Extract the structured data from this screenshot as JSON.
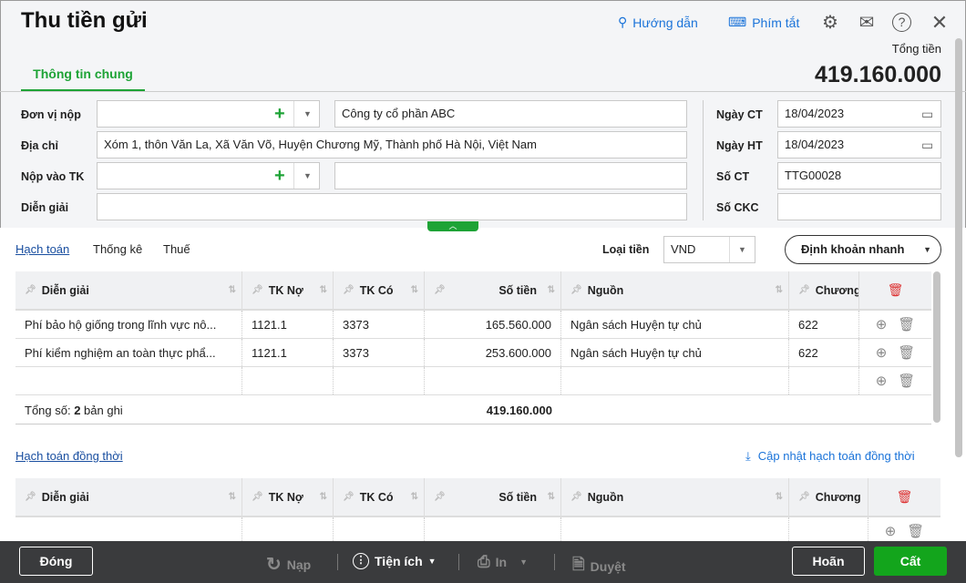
{
  "header": {
    "title": "Thu tiền gửi",
    "guide": "Hướng dẫn",
    "shortcuts": "Phím tắt",
    "total_label": "Tổng tiền",
    "total_value": "419.160.000"
  },
  "tabs": [
    {
      "label": "Thông tin chung",
      "active": true
    }
  ],
  "form": {
    "don_vi_nop": {
      "label": "Đơn vị nộp",
      "value": "",
      "name": "Công ty cổ phần ABC"
    },
    "dia_chi": {
      "label": "Địa chỉ",
      "value": "Xóm 1, thôn Văn La, Xã Văn Võ, Huyện Chương Mỹ, Thành phố Hà Nội, Việt Nam"
    },
    "nop_vao_tk": {
      "label": "Nộp vào TK",
      "value": "",
      "name": ""
    },
    "dien_giai": {
      "label": "Diễn giải",
      "value": ""
    },
    "ngay_ct": {
      "label": "Ngày CT",
      "value": "18/04/2023"
    },
    "ngay_ht": {
      "label": "Ngày HT",
      "value": "18/04/2023"
    },
    "so_ct": {
      "label": "Số CT",
      "value": "TTG00028"
    },
    "so_ckc": {
      "label": "Số CKC",
      "value": ""
    }
  },
  "detail_tabs": [
    "Hạch toán",
    "Thống kê",
    "Thuế"
  ],
  "currency": {
    "label": "Loại tiền",
    "value": "VND"
  },
  "quick_entry": "Định khoản nhanh",
  "columns": [
    "Diễn giải",
    "TK Nợ",
    "TK Có",
    "Số tiền",
    "Nguồn",
    "Chương"
  ],
  "rows": [
    [
      "Phí bảo hộ giống trong lĩnh vực nô...",
      "1121.1",
      "3373",
      "165.560.000",
      "Ngân sách Huyện tự chủ",
      "622"
    ],
    [
      "Phí kiểm nghiệm an toàn thực phẩ...",
      "1121.1",
      "3373",
      "253.600.000",
      "Ngân sách Huyện tự chủ",
      "622"
    ]
  ],
  "summary": {
    "prefix": "Tổng số: ",
    "count": "2",
    "suffix": " bản ghi",
    "total": "419.160.000"
  },
  "concurrent": {
    "title": "Hạch toán đồng thời",
    "update": "Cập nhật hạch toán đồng thời"
  },
  "footer": {
    "close": "Đóng",
    "reload": "Nạp",
    "utilities": "Tiện ích",
    "print": "In",
    "approve": "Duyệt",
    "cancel": "Hoãn",
    "save": "Cất"
  },
  "colors": {
    "accent": "#1ea336",
    "link": "#1a73d9",
    "footer": "#3a3b3d"
  }
}
